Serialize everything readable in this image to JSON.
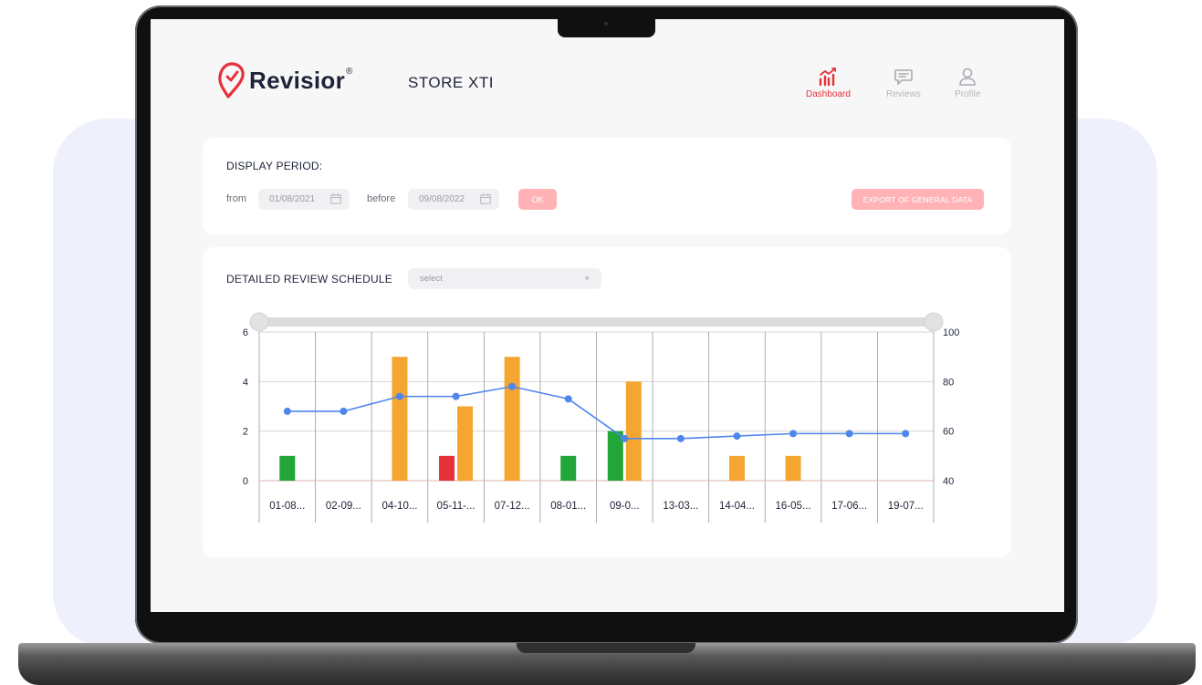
{
  "brand": {
    "name": "Revisior",
    "reg_mark": "®",
    "accent": "#e5323a"
  },
  "store": {
    "name": "STORE XTI"
  },
  "nav": {
    "dashboard": {
      "label": "Dashboard",
      "icon": "chart-icon",
      "active": true
    },
    "reviews": {
      "label": "Reviews",
      "icon": "message-icon"
    },
    "profile": {
      "label": "Profile",
      "icon": "user-icon"
    }
  },
  "period": {
    "title": "DISPLAY PERIOD:",
    "from_label": "from",
    "from_value": "01/08/2021",
    "before_label": "before",
    "before_value": "09/08/2022",
    "ok_label": "OK",
    "export_label": "EXPORT OF GENERAL DATA"
  },
  "schedule": {
    "title": "DETAILED REVIEW SCHEDULE",
    "select_placeholder": "select"
  },
  "chart_data": {
    "type": "bar",
    "categories": [
      "01-08...",
      "02-09...",
      "04-10...",
      "05-11-...",
      "07-12...",
      "08-01...",
      "09-0...",
      "13-03...",
      "14-04...",
      "16-05...",
      "17-06...",
      "19-07..."
    ],
    "left_ylim": [
      0,
      6
    ],
    "left_ticks": [
      0,
      2,
      4,
      6
    ],
    "right_ylim": [
      40,
      100
    ],
    "right_ticks": [
      40,
      60,
      80,
      100
    ],
    "grid": true,
    "range_slider": true,
    "series": [
      {
        "color": "#22a63a",
        "values": [
          1,
          0,
          0,
          0,
          0,
          1,
          2,
          0,
          0,
          0,
          0,
          0
        ]
      },
      {
        "color": "#e5323a",
        "values": [
          0,
          0,
          0,
          1,
          0,
          0,
          0,
          0,
          0,
          0,
          0,
          0
        ]
      },
      {
        "color": "#f5a630",
        "values": [
          0,
          0,
          5,
          3,
          5,
          0,
          4,
          0,
          1,
          1,
          0,
          0
        ]
      }
    ],
    "line": {
      "color": "#4f86ec",
      "axis": "right",
      "values": [
        68,
        68,
        74,
        74,
        78,
        73,
        57,
        57,
        58,
        59,
        59,
        59
      ]
    }
  }
}
